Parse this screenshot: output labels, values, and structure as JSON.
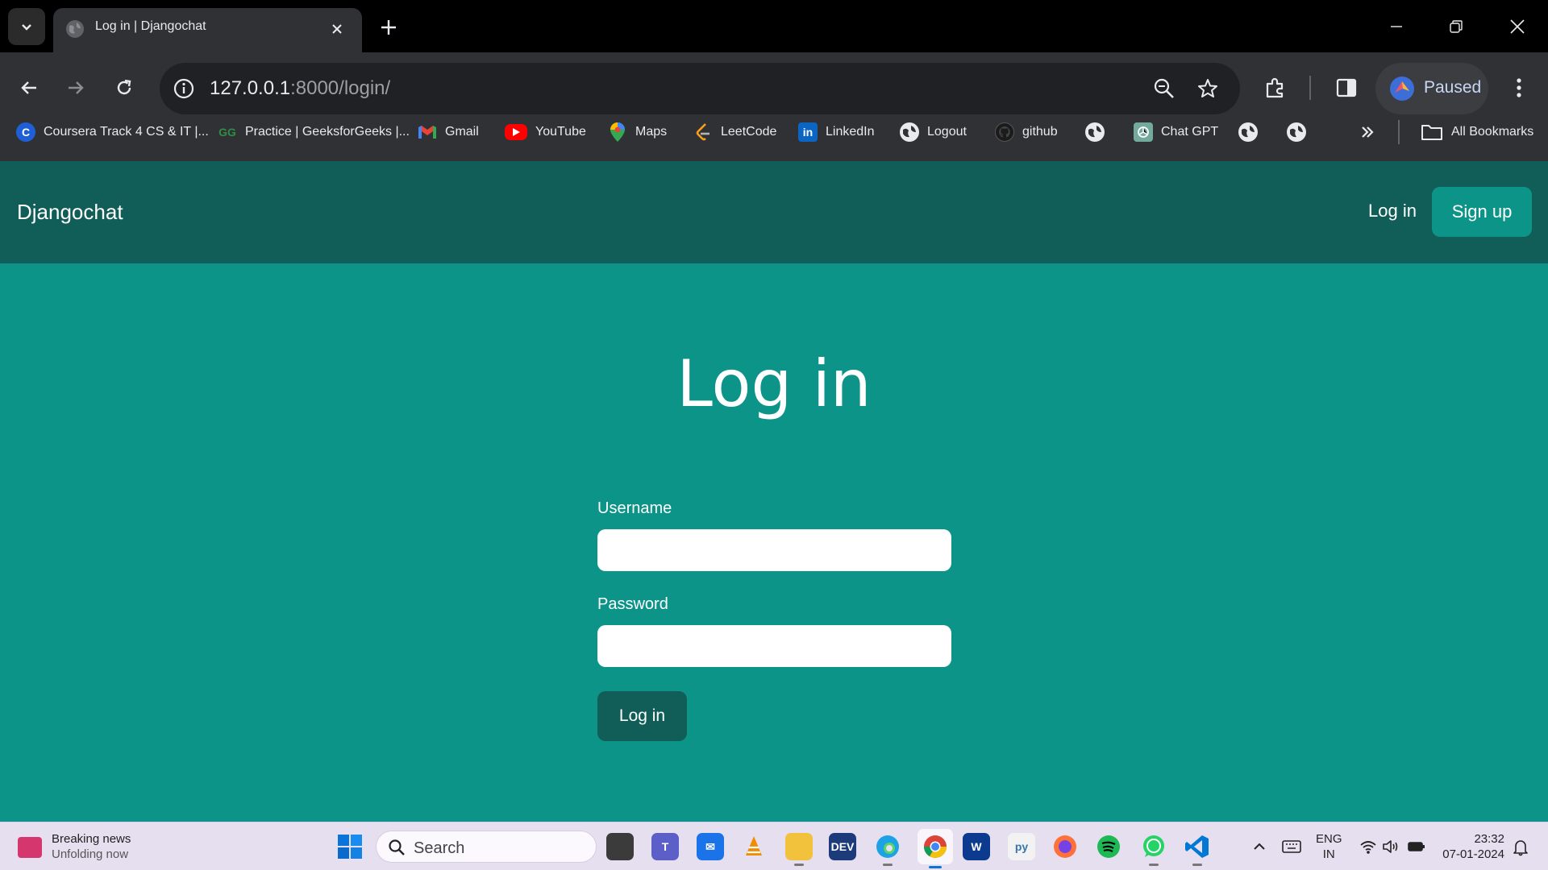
{
  "browser": {
    "tab_title": "Log in | Djangochat",
    "url_host": "127.0.0.1",
    "url_rest": ":8000/login/",
    "profile_label": "Paused",
    "bookmarks": [
      {
        "label": "Coursera Track 4 CS & IT |...",
        "icon": "coursera-icon"
      },
      {
        "label": "Practice | GeeksforGeeks |...",
        "icon": "geeksforgeeks-icon"
      },
      {
        "label": "Gmail",
        "icon": "gmail-icon"
      },
      {
        "label": "YouTube",
        "icon": "youtube-icon"
      },
      {
        "label": "Maps",
        "icon": "maps-icon"
      },
      {
        "label": "LeetCode",
        "icon": "leetcode-icon"
      },
      {
        "label": "LinkedIn",
        "icon": "linkedin-icon"
      },
      {
        "label": "Logout",
        "icon": "globe-icon"
      },
      {
        "label": "github",
        "icon": "github-icon"
      },
      {
        "label": "Chat GPT",
        "icon": "chatgpt-icon"
      }
    ],
    "all_bookmarks_label": "All Bookmarks"
  },
  "site": {
    "brand": "Djangochat",
    "nav_login": "Log in",
    "nav_signup": "Sign up",
    "heading": "Log in",
    "username_label": "Username",
    "password_label": "Password",
    "submit_label": "Log in"
  },
  "taskbar": {
    "news_title": "Breaking news",
    "news_subtitle": "Unfolding now",
    "search_placeholder": "Search",
    "lang_line1": "ENG",
    "lang_line2": "IN",
    "time": "23:32",
    "date": "07-01-2024"
  },
  "colors": {
    "page_bg": "#0d9488",
    "navbar_bg": "#115e59",
    "button_bg": "#115e59"
  }
}
